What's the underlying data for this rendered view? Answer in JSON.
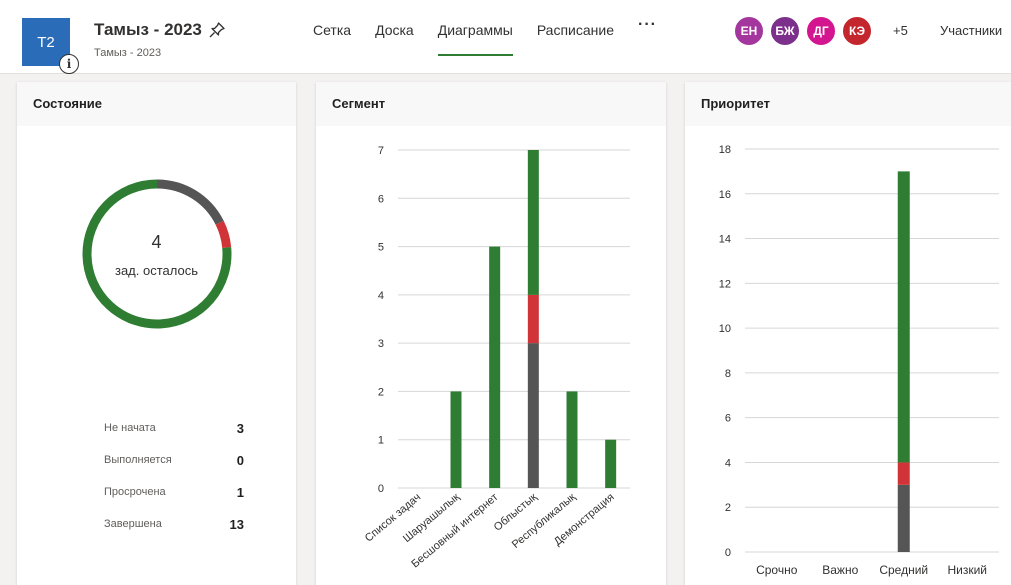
{
  "header": {
    "plan_initials": "T2",
    "plan_title": "Тамыз - 2023",
    "plan_subtitle": "Тамыз - 2023",
    "tabs": [
      {
        "label": "Сетка",
        "active": false
      },
      {
        "label": "Доска",
        "active": false
      },
      {
        "label": "Диаграммы",
        "active": true
      },
      {
        "label": "Расписание",
        "active": false
      }
    ],
    "more_tabs": "···",
    "avatars": [
      {
        "initials": "ЕН",
        "color": "#a4379e"
      },
      {
        "initials": "БЖ",
        "color": "#7d2f8c"
      },
      {
        "initials": "ДГ",
        "color": "#d3168f"
      },
      {
        "initials": "КЭ",
        "color": "#c4262e"
      }
    ],
    "more_members": "+5",
    "members_label": "Участники"
  },
  "colors": {
    "not_started": "#555555",
    "in_progress": "#2b6cb8",
    "overdue": "#d13438",
    "completed": "#2e7d32"
  },
  "status_card": {
    "title": "Состояние",
    "remaining_count": "4",
    "remaining_label": "зад. осталось",
    "legend": [
      {
        "label": "Не начата",
        "value": "3"
      },
      {
        "label": "Выполняется",
        "value": "0"
      },
      {
        "label": "Просрочена",
        "value": "1"
      },
      {
        "label": "Завершена",
        "value": "13"
      }
    ]
  },
  "segment_card": {
    "title": "Сегмент"
  },
  "priority_card": {
    "title": "Приоритет"
  },
  "chart_data": [
    {
      "type": "pie",
      "id": "status-donut",
      "categories": [
        "Не начата",
        "Выполняется",
        "Просрочена",
        "Завершена"
      ],
      "values": [
        3,
        0,
        1,
        13
      ],
      "center_value": 4,
      "center_label": "зад. осталось"
    },
    {
      "type": "bar",
      "id": "segment",
      "stacked": true,
      "categories": [
        "Список задач",
        "Шаруашылық",
        "Бесшовный интернет",
        "Облыстық",
        "Республикалық",
        "Демонстрация"
      ],
      "series": [
        {
          "status": "not_started",
          "values": [
            0,
            0,
            0,
            3,
            0,
            0
          ]
        },
        {
          "status": "overdue",
          "values": [
            0,
            0,
            0,
            1,
            0,
            0
          ]
        },
        {
          "status": "completed",
          "values": [
            0,
            2,
            5,
            3,
            2,
            1
          ]
        }
      ],
      "ylim": [
        0,
        7
      ],
      "yticks": [
        0,
        1,
        2,
        3,
        4,
        5,
        6,
        7
      ],
      "grid": true
    },
    {
      "type": "bar",
      "id": "priority",
      "stacked": true,
      "categories": [
        "Срочно",
        "Важно",
        "Средний",
        "Низкий"
      ],
      "series": [
        {
          "status": "not_started",
          "values": [
            0,
            0,
            3,
            0
          ]
        },
        {
          "status": "overdue",
          "values": [
            0,
            0,
            1,
            0
          ]
        },
        {
          "status": "completed",
          "values": [
            0,
            0,
            13,
            0
          ]
        }
      ],
      "ylim": [
        0,
        18
      ],
      "yticks": [
        0,
        2,
        4,
        6,
        8,
        10,
        12,
        14,
        16,
        18
      ],
      "grid": true
    }
  ]
}
